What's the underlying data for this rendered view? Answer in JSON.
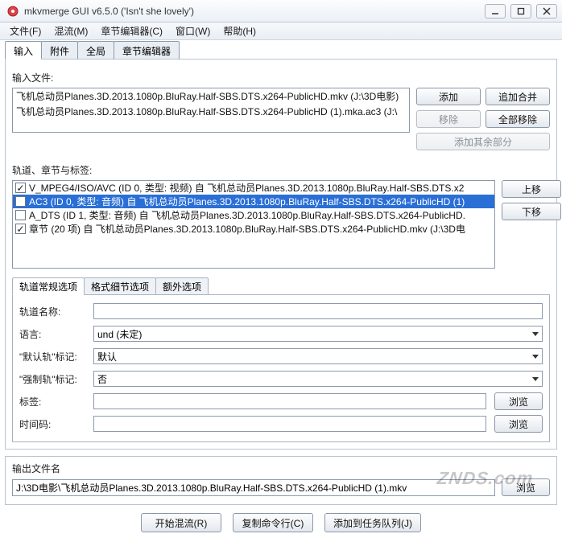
{
  "window": {
    "title": "mkvmerge GUI v6.5.0 ('Isn't she lovely')"
  },
  "menu": {
    "file": "文件(F)",
    "mux": "混流(M)",
    "chapedit": "章节编辑器(C)",
    "window": "窗口(W)",
    "help": "帮助(H)"
  },
  "main_tabs": {
    "input": "输入",
    "attach": "附件",
    "global": "全局",
    "chapedit": "章节编辑器"
  },
  "input": {
    "files_label": "输入文件:",
    "files": [
      "飞机总动员Planes.3D.2013.1080p.BluRay.Half-SBS.DTS.x264-PublicHD.mkv (J:\\3D电影)",
      "飞机总动员Planes.3D.2013.1080p.BluRay.Half-SBS.DTS.x264-PublicHD (1).mka.ac3 (J:\\"
    ],
    "buttons": {
      "add": "添加",
      "add_merge": "追加合并",
      "remove": "移除",
      "remove_all": "全部移除",
      "add_other": "添加其余部分"
    },
    "tracks_label": "轨道、章节与标签:",
    "tracks": [
      {
        "checked": true,
        "selected": false,
        "text": "V_MPEG4/ISO/AVC (ID 0, 类型: 视频) 自 飞机总动员Planes.3D.2013.1080p.BluRay.Half-SBS.DTS.x2"
      },
      {
        "checked": true,
        "selected": true,
        "text": "AC3 (ID 0, 类型: 音频) 自 飞机总动员Planes.3D.2013.1080p.BluRay.Half-SBS.DTS.x264-PublicHD (1)"
      },
      {
        "checked": false,
        "selected": false,
        "text": "A_DTS (ID 1, 类型: 音频) 自 飞机总动员Planes.3D.2013.1080p.BluRay.Half-SBS.DTS.x264-PublicHD."
      },
      {
        "checked": true,
        "selected": false,
        "text": "章节 (20 项) 自 飞机总动员Planes.3D.2013.1080p.BluRay.Half-SBS.DTS.x264-PublicHD.mkv (J:\\3D电"
      }
    ],
    "move_up": "上移",
    "move_down": "下移"
  },
  "track_opts_tabs": {
    "general": "轨道常规选项",
    "format": "格式细节选项",
    "extra": "额外选项"
  },
  "track_form": {
    "name_label": "轨道名称:",
    "name_value": "",
    "lang_label": "语言:",
    "lang_value": "und (未定)",
    "default_label": "\"默认轨\"标记:",
    "default_value": "默认",
    "forced_label": "\"强制轨\"标记:",
    "forced_value": "否",
    "tags_label": "标签:",
    "tags_value": "",
    "tc_label": "时间码:",
    "tc_value": "",
    "browse": "浏览"
  },
  "output": {
    "label": "输出文件名",
    "path": "J:\\3D电影\\飞机总动员Planes.3D.2013.1080p.BluRay.Half-SBS.DTS.x264-PublicHD (1).mkv",
    "browse": "浏览"
  },
  "actions": {
    "start": "开始混流(R)",
    "copy": "复制命令行(C)",
    "queue": "添加到任务队列(J)"
  },
  "watermark": "ZNDS.com"
}
